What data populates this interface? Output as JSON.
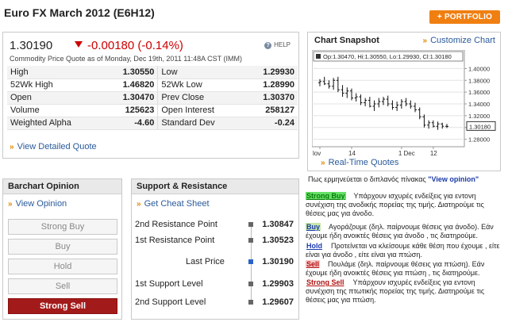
{
  "page": {
    "title": "Euro FX March 2012 (E6H12)",
    "portfolio_label": "+ PORTFOLIO"
  },
  "quote": {
    "price": "1.30190",
    "change": "-0.00180 (-0.14%)",
    "help": "HELP",
    "subtitle": "Commodity Price Quote as of Monday, Dec 19th, 2011 11:48A CST (IMM)",
    "rows": [
      {
        "l_label": "High",
        "l_value": "1.30550",
        "r_label": "Low",
        "r_value": "1.29930"
      },
      {
        "l_label": "52Wk High",
        "l_value": "1.46820",
        "r_label": "52Wk Low",
        "r_value": "1.28990"
      },
      {
        "l_label": "Open",
        "l_value": "1.30470",
        "r_label": "Prev Close",
        "r_value": "1.30370"
      },
      {
        "l_label": "Volume",
        "l_value": "125623",
        "r_label": "Open Interest",
        "r_value": "258127"
      },
      {
        "l_label": "Weighted Alpha",
        "l_value": "-4.60",
        "r_label": "Standard Dev",
        "r_value": "-0.24"
      }
    ],
    "detail_link": "View Detailed Quote"
  },
  "chart": {
    "title": "Chart Snapshot",
    "custom_link": "Customize Chart",
    "ohlc_readout": "Op:1.30470, Hi:1.30550, Lo:1.29930, Cl:1.30180",
    "last_label": "1.30180",
    "realtime_link": "Real-Time Quotes"
  },
  "chart_data": {
    "type": "ohlc",
    "y_ticks": [
      "1.40000",
      "1.38000",
      "1.36000",
      "1.34000",
      "1.32000",
      "1.30000",
      "1.28000"
    ],
    "ylim": [
      1.27,
      1.41
    ],
    "x_labels": [
      "lov",
      "14",
      "1 Dec",
      "12"
    ],
    "last": 1.3018,
    "bars": [
      {
        "o": 1.376,
        "h": 1.382,
        "l": 1.37,
        "c": 1.378
      },
      {
        "o": 1.378,
        "h": 1.386,
        "l": 1.372,
        "c": 1.374
      },
      {
        "o": 1.374,
        "h": 1.38,
        "l": 1.366,
        "c": 1.37
      },
      {
        "o": 1.37,
        "h": 1.384,
        "l": 1.364,
        "c": 1.38
      },
      {
        "o": 1.38,
        "h": 1.386,
        "l": 1.36,
        "c": 1.364
      },
      {
        "o": 1.364,
        "h": 1.372,
        "l": 1.352,
        "c": 1.358
      },
      {
        "o": 1.358,
        "h": 1.368,
        "l": 1.35,
        "c": 1.362
      },
      {
        "o": 1.362,
        "h": 1.366,
        "l": 1.346,
        "c": 1.35
      },
      {
        "o": 1.35,
        "h": 1.358,
        "l": 1.344,
        "c": 1.352
      },
      {
        "o": 1.352,
        "h": 1.356,
        "l": 1.338,
        "c": 1.342
      },
      {
        "o": 1.342,
        "h": 1.35,
        "l": 1.336,
        "c": 1.346
      },
      {
        "o": 1.346,
        "h": 1.352,
        "l": 1.334,
        "c": 1.336
      },
      {
        "o": 1.336,
        "h": 1.346,
        "l": 1.328,
        "c": 1.34
      },
      {
        "o": 1.34,
        "h": 1.35,
        "l": 1.334,
        "c": 1.344
      },
      {
        "o": 1.344,
        "h": 1.352,
        "l": 1.338,
        "c": 1.348
      },
      {
        "o": 1.348,
        "h": 1.354,
        "l": 1.336,
        "c": 1.34
      },
      {
        "o": 1.34,
        "h": 1.346,
        "l": 1.33,
        "c": 1.334
      },
      {
        "o": 1.334,
        "h": 1.344,
        "l": 1.328,
        "c": 1.338
      },
      {
        "o": 1.338,
        "h": 1.348,
        "l": 1.332,
        "c": 1.344
      },
      {
        "o": 1.344,
        "h": 1.35,
        "l": 1.336,
        "c": 1.34
      },
      {
        "o": 1.34,
        "h": 1.346,
        "l": 1.332,
        "c": 1.336
      },
      {
        "o": 1.336,
        "h": 1.342,
        "l": 1.326,
        "c": 1.33
      },
      {
        "o": 1.33,
        "h": 1.334,
        "l": 1.314,
        "c": 1.318
      },
      {
        "o": 1.318,
        "h": 1.322,
        "l": 1.3,
        "c": 1.304
      },
      {
        "o": 1.304,
        "h": 1.312,
        "l": 1.298,
        "c": 1.308
      },
      {
        "o": 1.308,
        "h": 1.312,
        "l": 1.3,
        "c": 1.302
      },
      {
        "o": 1.302,
        "h": 1.31,
        "l": 1.296,
        "c": 1.306
      },
      {
        "o": 1.306,
        "h": 1.308,
        "l": 1.298,
        "c": 1.302
      },
      {
        "o": 1.302,
        "h": 1.306,
        "l": 1.299,
        "c": 1.3018
      }
    ]
  },
  "opinion": {
    "title": "Barchart Opinion",
    "link": "View Opinion",
    "buttons": [
      "Strong Buy",
      "Buy",
      "Hold",
      "Sell",
      "Strong Sell"
    ],
    "active": "Strong Sell"
  },
  "support": {
    "title": "Support & Resistance",
    "link": "Get Cheat Sheet",
    "rows": [
      {
        "label": "2nd Resistance Point",
        "value": "1.30847"
      },
      {
        "label": "1st Resistance Point",
        "value": "1.30523"
      },
      {
        "label": "Last Price",
        "value": "1.30190"
      },
      {
        "label": "1st Support Level",
        "value": "1.29903"
      },
      {
        "label": "2nd Support Level",
        "value": "1.29607"
      }
    ]
  },
  "notes": {
    "intro": "Πως ερμηνεύεται ο διπλανός πίνακας",
    "intro_link": "\"View opinion\"",
    "items": [
      {
        "tag": "Strong Buy",
        "text": "Υπάρχουν ισχυρές ενδείξεις για εντονη συνέχιση της ανοδικής πορείας της τιμής. Διατηρούμε τις θέσεις μας για άνοδο."
      },
      {
        "tag": "Buy",
        "text": "Αγοράζουμε (δηλ. παίρνουμε θέσεις για άνοδο). Εάν έχουμε ήδη ανοικτές θέσεις για άνοδο , τις διατηρούμε."
      },
      {
        "tag": "Hold",
        "text": "Προτείνεται να κλείσουμε κάθε θέση που έχουμε , είτε είναι για άνοδο , είτε είναι για πτώση."
      },
      {
        "tag": "Sell",
        "text": "Πουλάμε (δηλ. παίρνουμε θέσεις για πτώση). Εάν έχουμε ήδη ανοικτές θέσεις για πτώση , τις διατηρούμε."
      },
      {
        "tag": "Strong Sell",
        "text": "Υπάρχουν ισχυρές ενδείξεις για εντονη συνέχιση της πτωτικής πορείας της τιμής. Διατηρούμε τις θέσεις μας για πτώση."
      }
    ]
  }
}
